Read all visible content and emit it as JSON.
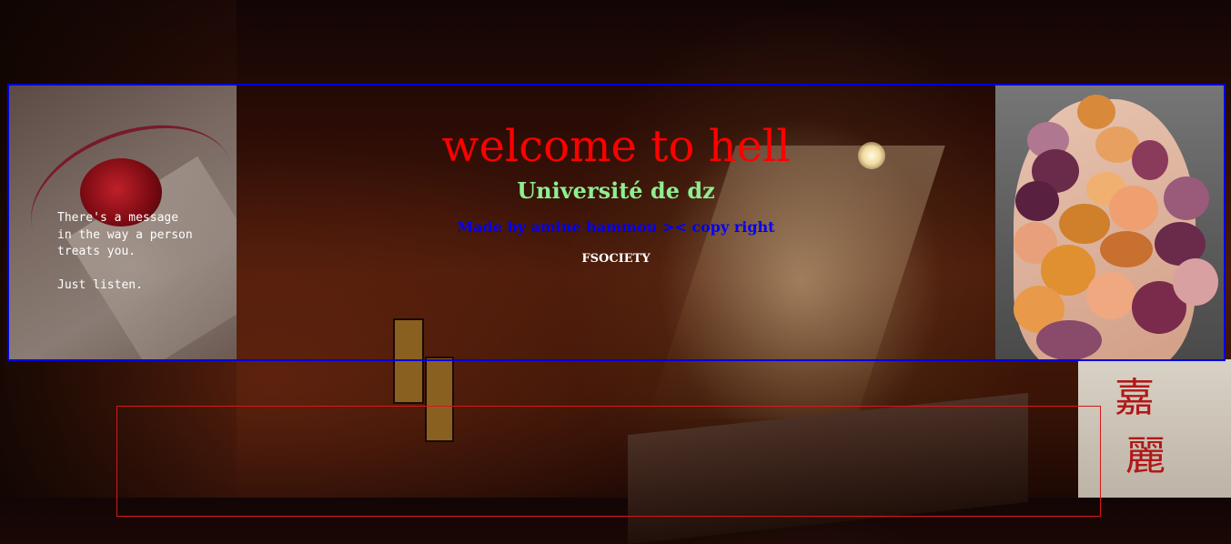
{
  "banner": {
    "title": "welcome to hell",
    "subtitle": "Université de dz",
    "credit": "Made by amine hammou >< copy right",
    "tag": "FSOCIETY"
  },
  "left_image": {
    "quote": "There's a message\nin the way a person\ntreats you.\n\nJust listen."
  },
  "colors": {
    "title": "#ff0000",
    "subtitle": "#90ee90",
    "credit": "#0000ff",
    "tag": "#ffffff",
    "banner_border": "#0000dd",
    "content_border": "#d81818"
  }
}
